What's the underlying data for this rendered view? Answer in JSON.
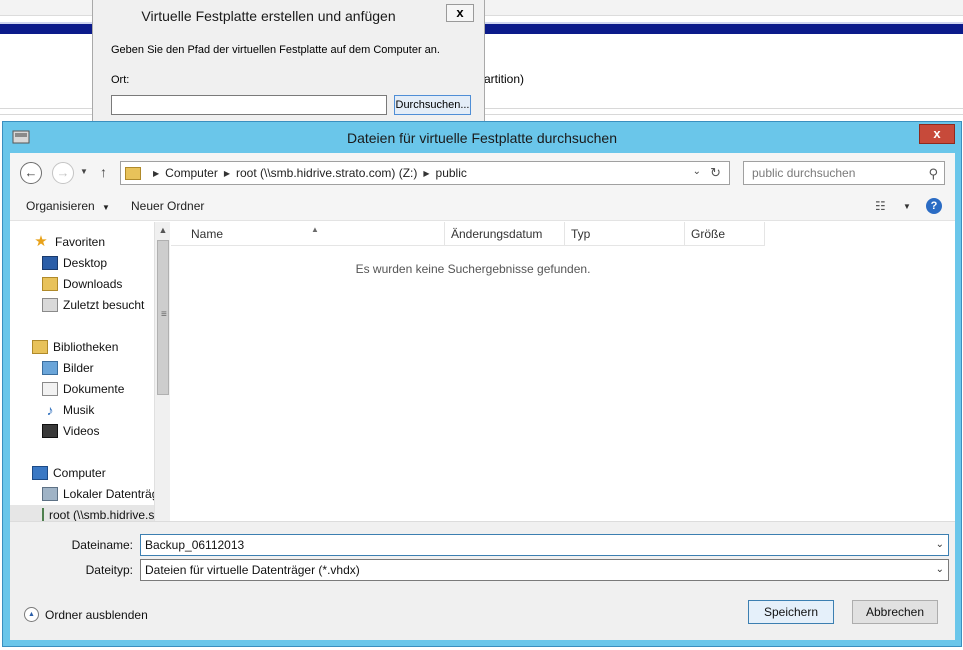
{
  "background_window": {
    "partition_text": "artition)"
  },
  "wizard": {
    "title": "Virtuelle Festplatte erstellen und anfügen",
    "instruction": "Geben Sie den Pfad der virtuellen Festplatte auf dem Computer an.",
    "location_label": "Ort:",
    "location_value": "",
    "browse_label": "Durchsuchen...",
    "close_glyph": "x"
  },
  "dialog": {
    "title": "Dateien für virtuelle Festplatte durchsuchen",
    "close_glyph": "x",
    "address": {
      "breadcrumbs": [
        "Computer",
        "root (\\\\smb.hidrive.strato.com) (Z:)",
        "public"
      ]
    },
    "search": {
      "placeholder": "public durchsuchen"
    },
    "toolbar": {
      "organize_label": "Organisieren",
      "new_folder_label": "Neuer Ordner",
      "help_glyph": "?"
    },
    "nav": {
      "favorites": "Favoriten",
      "desktop": "Desktop",
      "downloads": "Downloads",
      "recent": "Zuletzt besucht",
      "libraries": "Bibliotheken",
      "pictures": "Bilder",
      "documents": "Dokumente",
      "music": "Musik",
      "videos": "Videos",
      "computer": "Computer",
      "local_disk": "Lokaler Datenträger",
      "network_drive": "root (\\\\smb.hidrive.strato.com) (Z:)"
    },
    "columns": [
      "Name",
      "Änderungsdatum",
      "Typ",
      "Größe"
    ],
    "empty_message": "Es wurden keine Suchergebnisse gefunden.",
    "filename_label": "Dateiname:",
    "filename_value": "Backup_06112013",
    "filetype_label": "Dateityp:",
    "filetype_value": "Dateien für virtuelle Datenträger (*.vhdx)",
    "hide_folders_label": "Ordner ausblenden",
    "save_label": "Speichern",
    "cancel_label": "Abbrechen"
  }
}
